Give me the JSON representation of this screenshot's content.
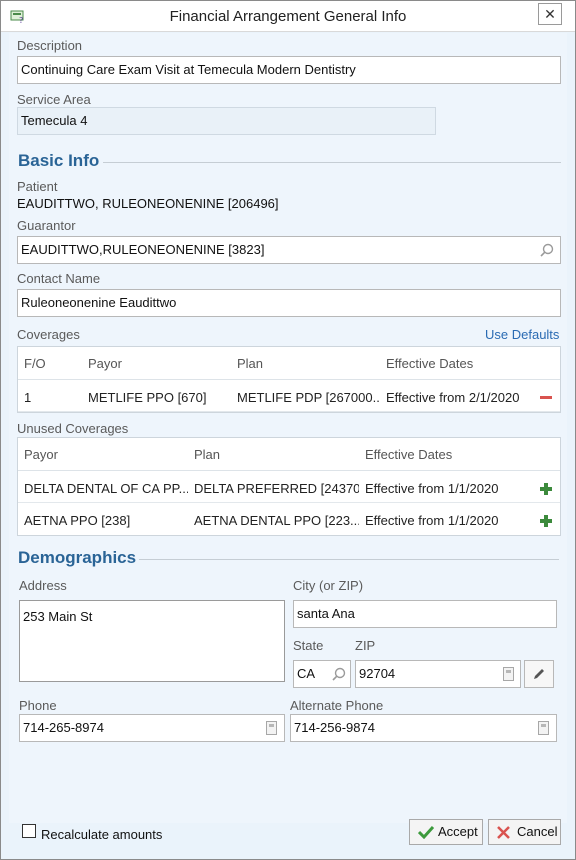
{
  "window": {
    "title": "Financial Arrangement General Info"
  },
  "description": {
    "label": "Description",
    "value": "Continuing Care Exam Visit at Temecula Modern Dentistry"
  },
  "service_area": {
    "label": "Service Area",
    "value": "Temecula 4"
  },
  "basic_info": {
    "heading": "Basic Info",
    "patient_label": "Patient",
    "patient_value": "EAUDITTWO, RULEONEONENINE [206496]",
    "guarantor_label": "Guarantor",
    "guarantor_value": "EAUDITTWO,RULEONEONENINE [3823]",
    "contact_label": "Contact Name",
    "contact_value": "Ruleoneonenine Eaudittwo"
  },
  "coverages": {
    "label": "Coverages",
    "use_defaults": "Use Defaults",
    "headers": [
      "F/O",
      "Payor",
      "Plan",
      "Effective Dates"
    ],
    "rows": [
      {
        "fo": "1",
        "payor": "METLIFE PPO [670]",
        "plan": "METLIFE PDP [267000...",
        "dates": "Effective from 2/1/2020"
      }
    ]
  },
  "unused_coverages": {
    "label": "Unused Coverages",
    "headers": [
      "Payor",
      "Plan",
      "Effective Dates"
    ],
    "rows": [
      {
        "payor": "DELTA DENTAL OF CA PP...",
        "plan": "DELTA PREFERRED [24370...",
        "dates": "Effective from 1/1/2020"
      },
      {
        "payor": "AETNA PPO [238]",
        "plan": "AETNA DENTAL PPO [223...",
        "dates": "Effective from 1/1/2020"
      }
    ]
  },
  "demographics": {
    "heading": "Demographics",
    "address_label": "Address",
    "address_value": "253 Main St",
    "city_label": "City (or ZIP)",
    "city_value": "santa Ana",
    "state_label": "State",
    "state_value": "CA",
    "zip_label": "ZIP",
    "zip_value": "92704",
    "phone_label": "Phone",
    "phone_value": "714-265-8974",
    "alt_phone_label": "Alternate Phone",
    "alt_phone_value": "714-256-9874"
  },
  "footer": {
    "recalc_label": "Recalculate amounts",
    "accept_label": "Accept",
    "cancel_label": "Cancel"
  },
  "colors": {
    "accent": "#2a6496",
    "link": "#2a6bb3",
    "remove": "#d9534f",
    "add": "#3c8a3c",
    "panel": "#eef5fc"
  },
  "icons": [
    "app-icon",
    "close-icon",
    "search-icon",
    "minus-icon",
    "plus-icon",
    "calculator-icon",
    "pencil-icon",
    "check-icon",
    "x-icon"
  ]
}
